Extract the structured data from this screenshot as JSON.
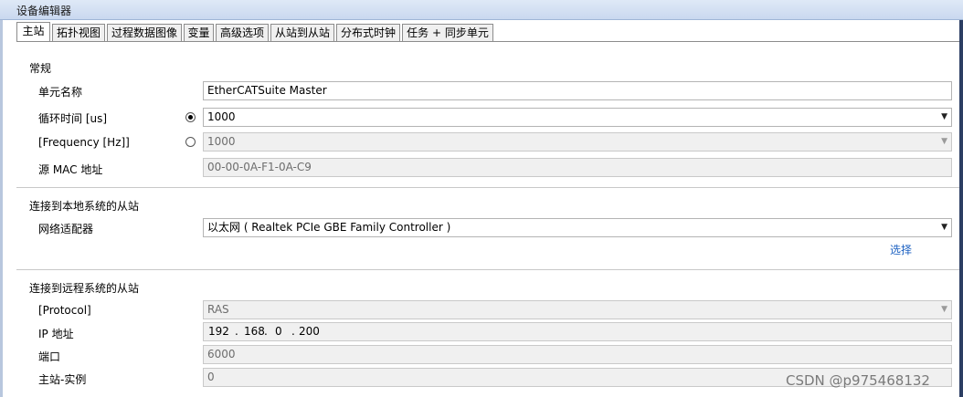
{
  "window": {
    "title": "设备编辑器"
  },
  "tabs": [
    {
      "label": "主站"
    },
    {
      "label": "拓扑视图"
    },
    {
      "label": "过程数据图像"
    },
    {
      "label": "变量"
    },
    {
      "label": "高级选项"
    },
    {
      "label": "从站到从站"
    },
    {
      "label": "分布式时钟"
    },
    {
      "label": "任务 + 同步单元"
    }
  ],
  "general": {
    "section_label": "常规",
    "unit_name": {
      "label": "单元名称",
      "value": "EtherCATSuite Master"
    },
    "cycle_time": {
      "label": "循环时间 [us]",
      "value": "1000",
      "selected": true
    },
    "frequency": {
      "label": "[Frequency [Hz]]",
      "value": "1000",
      "selected": false
    },
    "source_mac": {
      "label": "源 MAC 地址",
      "value": "00-00-0A-F1-0A-C9"
    }
  },
  "local": {
    "section_label": "连接到本地系统的从站",
    "adapter": {
      "label": "网络适配器",
      "value": "以太网 ( Realtek PCIe GBE Family Controller )"
    },
    "select_link": "选择"
  },
  "remote": {
    "section_label": "连接到远程系统的从站",
    "protocol": {
      "label": "[Protocol]",
      "value": "RAS"
    },
    "ip": {
      "label": "IP 地址",
      "octets": [
        "192",
        "168",
        "0",
        "200"
      ]
    },
    "port": {
      "label": "端口",
      "value": "6000"
    },
    "instance": {
      "label": "主站-实例",
      "value": "0"
    }
  },
  "watermark": "CSDN @p975468132"
}
